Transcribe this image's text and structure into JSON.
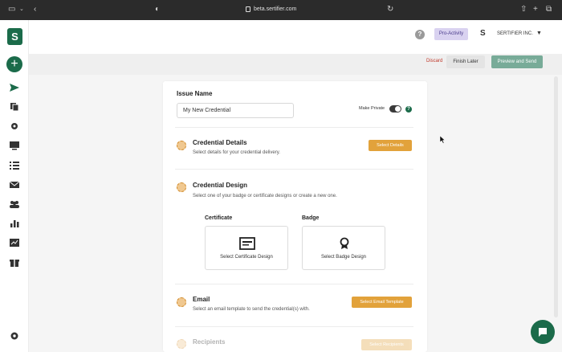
{
  "browser": {
    "url": "beta.sertifier.com"
  },
  "header": {
    "help_icon": "?",
    "plan_badge": "Pro-Activity",
    "org_initial": "S",
    "org_name": "SERTIFIER INC.",
    "org_caret": "▼"
  },
  "sidebar": {
    "logo": "S",
    "add_label": "+",
    "items": [
      {
        "icon": "send-icon"
      },
      {
        "icon": "copy-icon"
      },
      {
        "icon": "settings-icon"
      },
      {
        "icon": "monitor-icon"
      },
      {
        "icon": "list-icon"
      },
      {
        "icon": "mail-icon"
      },
      {
        "icon": "users-icon"
      },
      {
        "icon": "chart-icon"
      },
      {
        "icon": "analytics-icon"
      },
      {
        "icon": "gift-icon"
      }
    ],
    "settings_icon": "gear-icon"
  },
  "actions": {
    "discard": "Discard",
    "finish_later": "Finish Later",
    "preview_send": "Preview and Send"
  },
  "form": {
    "issue_name_label": "Issue Name",
    "issue_name_value": "My New Credential",
    "make_private_label": "Make Private",
    "make_private_on": false,
    "info_icon": "?"
  },
  "steps": {
    "details": {
      "title": "Credential Details",
      "description": "Select details for your credential delivery.",
      "button": "Select Details"
    },
    "design": {
      "title": "Credential Design",
      "description": "Select one of your badge or certificate designs or create a new one.",
      "certificate_label": "Certificate",
      "certificate_button": "Select Certificate Design",
      "badge_label": "Badge",
      "badge_button": "Select Badge Design"
    },
    "email": {
      "title": "Email",
      "description": "Select an email template to send the credential(s) with.",
      "button": "Select Email Template"
    },
    "recipients": {
      "title": "Recipients",
      "button": "Select Recipients"
    }
  },
  "colors": {
    "brand_green": "#1b6b4a",
    "accent_orange": "#e2a23b",
    "discard_red": "#c0392b",
    "preview_green": "#78ab98"
  }
}
